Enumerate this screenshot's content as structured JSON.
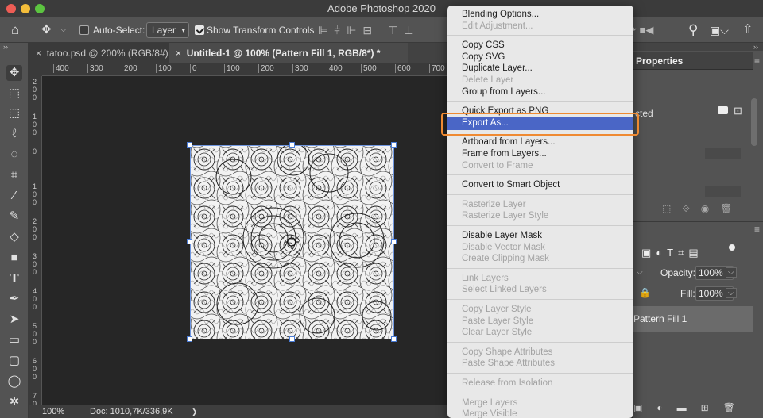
{
  "window": {
    "title": "Adobe Photoshop 2020"
  },
  "options_bar": {
    "auto_select_label": "Auto-Select:",
    "auto_select_value": "Layer",
    "show_transform_label": "Show Transform Controls"
  },
  "tabs": [
    {
      "label": "tatoo.psd @ 200% (RGB/8#)",
      "active": false
    },
    {
      "label": "Untitled-1 @ 100% (Pattern Fill 1, RGB/8*) *",
      "active": true
    }
  ],
  "ruler": {
    "h_ticks": [
      "400",
      "300",
      "200",
      "100",
      "0",
      "100",
      "200",
      "300",
      "400",
      "500",
      "600",
      "700"
    ],
    "v_ticks": [
      "200",
      "100",
      "0",
      "100",
      "200",
      "300",
      "400",
      "500",
      "600",
      "700"
    ]
  },
  "status_bar": {
    "zoom": "100%",
    "doc": "Doc: 1010,7K/336,9K",
    "arrow": "❯"
  },
  "right_panel": {
    "properties_title": "Properties",
    "cted_fragment": "cted",
    "opacity_label": "Opacity:",
    "opacity_value": "100%",
    "fill_label": "Fill:",
    "fill_value": "100%",
    "layer_name": "Pattern Fill 1"
  },
  "context_menu": {
    "items": [
      {
        "label": "Blending Options...",
        "enabled": true
      },
      {
        "label": "Edit Adjustment...",
        "enabled": false
      },
      {
        "label": "Copy CSS",
        "enabled": true
      },
      {
        "label": "Copy SVG",
        "enabled": true
      },
      {
        "label": "Duplicate Layer...",
        "enabled": true
      },
      {
        "label": "Delete Layer",
        "enabled": false
      },
      {
        "label": "Group from Layers...",
        "enabled": true
      },
      {
        "label": "Quick Export as PNG",
        "enabled": true
      },
      {
        "label": "Export As...",
        "enabled": true,
        "highlighted": true
      },
      {
        "label": "Artboard from Layers...",
        "enabled": true
      },
      {
        "label": "Frame from Layers...",
        "enabled": true
      },
      {
        "label": "Convert to Frame",
        "enabled": false
      },
      {
        "label": "Convert to Smart Object",
        "enabled": true
      },
      {
        "label": "Rasterize Layer",
        "enabled": false
      },
      {
        "label": "Rasterize Layer Style",
        "enabled": false
      },
      {
        "label": "Disable Layer Mask",
        "enabled": true
      },
      {
        "label": "Disable Vector Mask",
        "enabled": false
      },
      {
        "label": "Create Clipping Mask",
        "enabled": false
      },
      {
        "label": "Link Layers",
        "enabled": false
      },
      {
        "label": "Select Linked Layers",
        "enabled": false
      },
      {
        "label": "Copy Layer Style",
        "enabled": false
      },
      {
        "label": "Paste Layer Style",
        "enabled": false
      },
      {
        "label": "Clear Layer Style",
        "enabled": false
      },
      {
        "label": "Copy Shape Attributes",
        "enabled": false
      },
      {
        "label": "Paste Shape Attributes",
        "enabled": false
      },
      {
        "label": "Release from Isolation",
        "enabled": false
      },
      {
        "label": "Merge Layers",
        "enabled": false
      },
      {
        "label": "Merge Visible",
        "enabled": false
      }
    ]
  },
  "colors": {
    "highlight": "#4a66c6",
    "callout": "#ef8a32",
    "panel": "#535353",
    "canvas_bg": "#262626"
  },
  "icons": [
    "close-window-icon",
    "minimize-window-icon",
    "zoom-window-icon",
    "home-icon",
    "move-tool-icon",
    "align-left-icon",
    "search-icon",
    "workspace-icon",
    "share-icon",
    "marquee-icon",
    "lasso-icon",
    "crop-icon",
    "eyedropper-icon",
    "brush-icon",
    "eraser-icon",
    "gradient-icon",
    "type-icon",
    "pen-icon",
    "path-select-icon",
    "rectangle-icon",
    "hand-icon",
    "lock-icon",
    "eye-icon",
    "trash-icon"
  ]
}
